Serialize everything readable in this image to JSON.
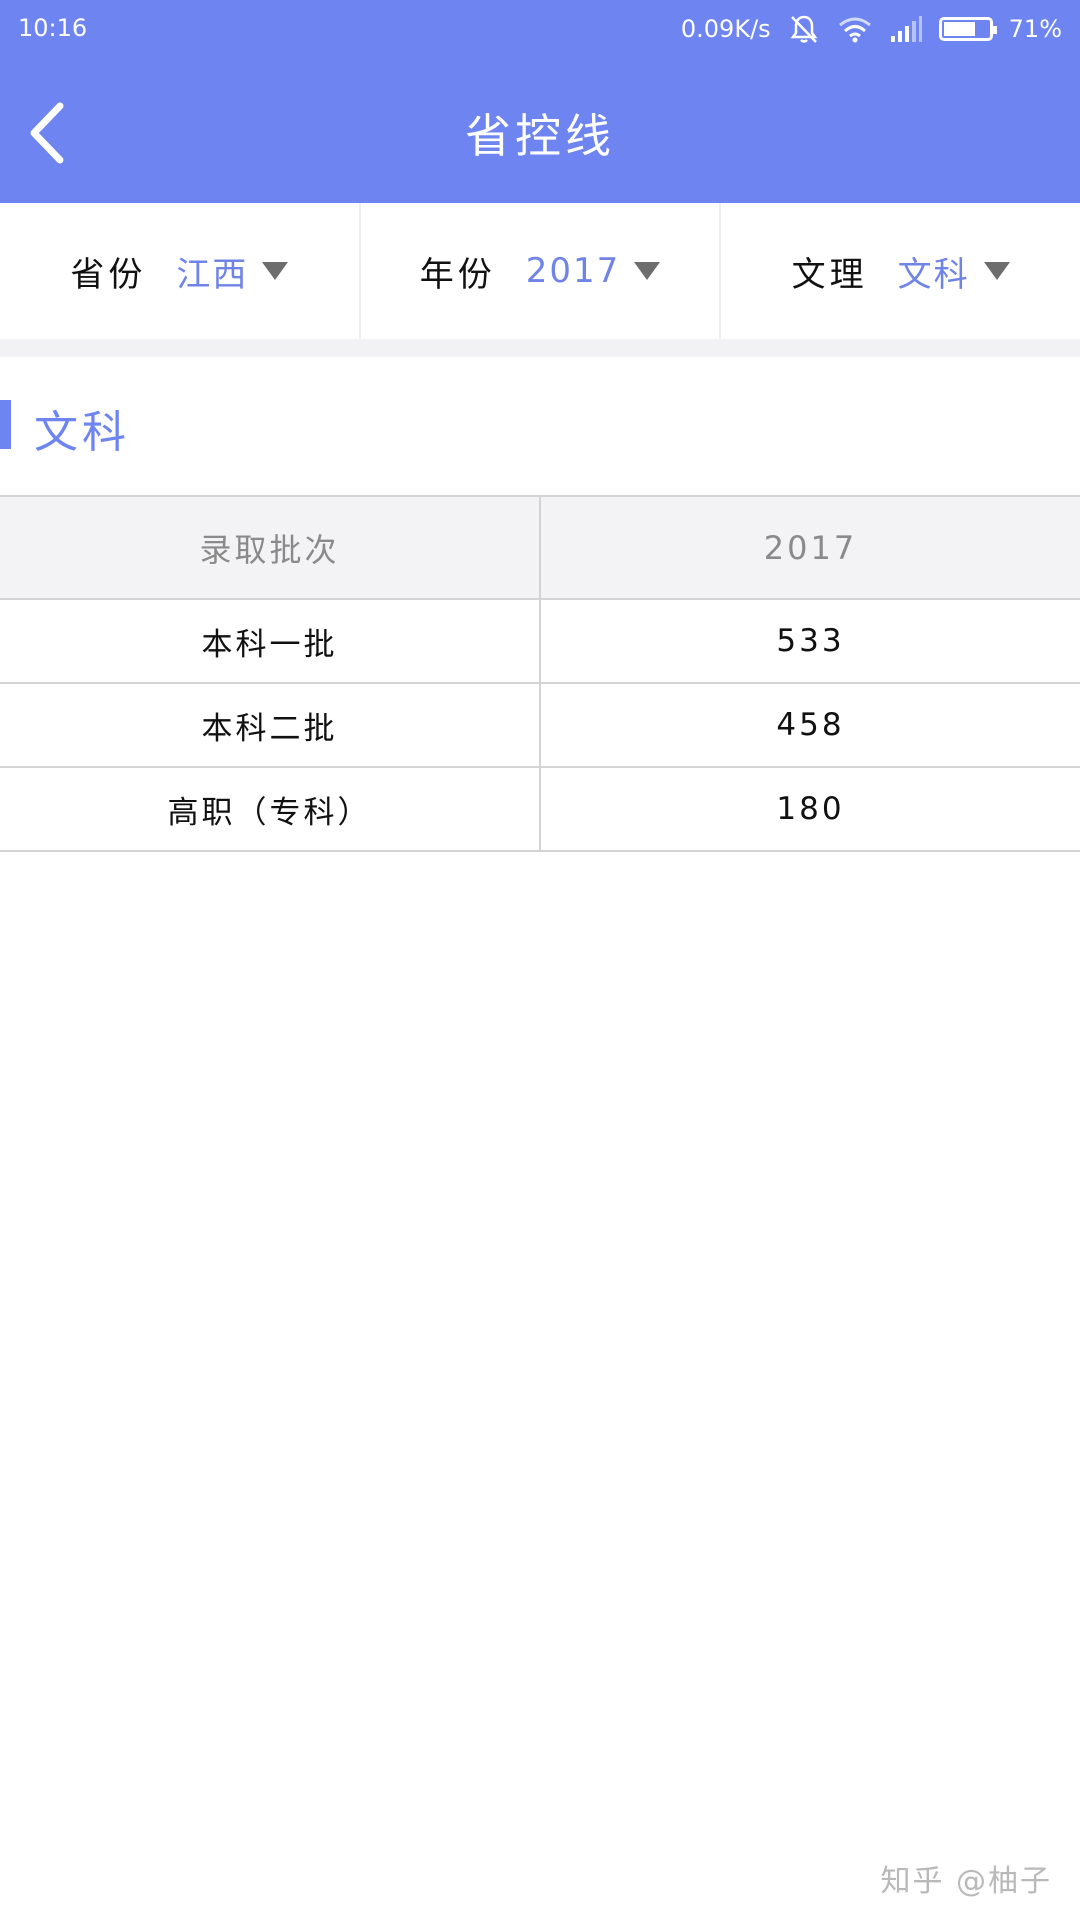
{
  "status_bar": {
    "time": "10:16",
    "network_speed": "0.09K/s",
    "battery_percent_text": "71%",
    "battery_level": 0.71,
    "icons": [
      "mute-icon",
      "wifi-icon",
      "signal-icon",
      "battery-icon"
    ]
  },
  "header": {
    "title": "省控线",
    "back_icon": "chevron-left-icon",
    "color": "#6d84f1"
  },
  "filters": [
    {
      "label": "省份",
      "value": "江西"
    },
    {
      "label": "年份",
      "value": "2017"
    },
    {
      "label": "文理",
      "value": "文科"
    }
  ],
  "section": {
    "title": "文科"
  },
  "table": {
    "columns": [
      "录取批次",
      "2017"
    ],
    "rows": [
      [
        "本科一批",
        "533"
      ],
      [
        "本科二批",
        "458"
      ],
      [
        "高职（专科）",
        "180"
      ]
    ]
  },
  "watermark": "知乎 @柚子",
  "colors": {
    "accent": "#6d84f1",
    "filter_value": "#6f84e6"
  }
}
